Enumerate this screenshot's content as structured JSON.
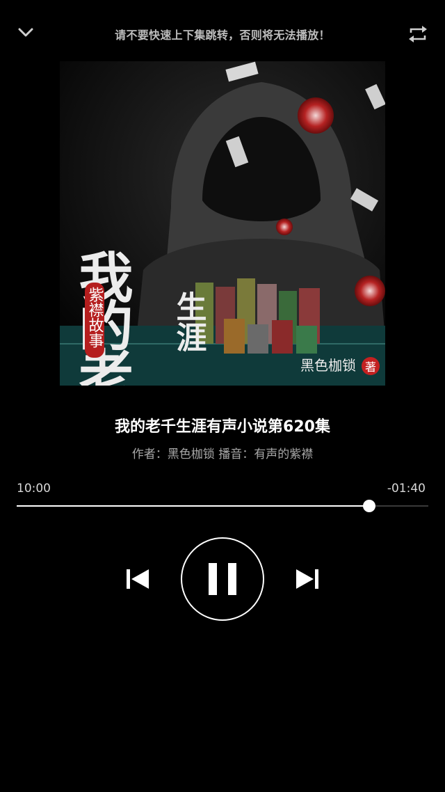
{
  "header": {
    "warning_text": "请不要快速上下集跳转，否则将无法播放！",
    "back_icon": "chevron-down-icon",
    "repeat_icon": "repeat-icon"
  },
  "cover": {
    "title_text": "我的老千",
    "title_text_2": "生涯",
    "badge_text": "紫襟故事",
    "author_stamp": "黑色枷锁",
    "stamp_char": "著"
  },
  "track": {
    "title": "我的老千生涯有声小说第620集",
    "credits": "作者：黑色枷锁 播音：有声的紫襟"
  },
  "player": {
    "elapsed": "10:00",
    "remaining": "-01:40",
    "progress": 0.857,
    "state": "playing",
    "accent": "#ffffff"
  }
}
